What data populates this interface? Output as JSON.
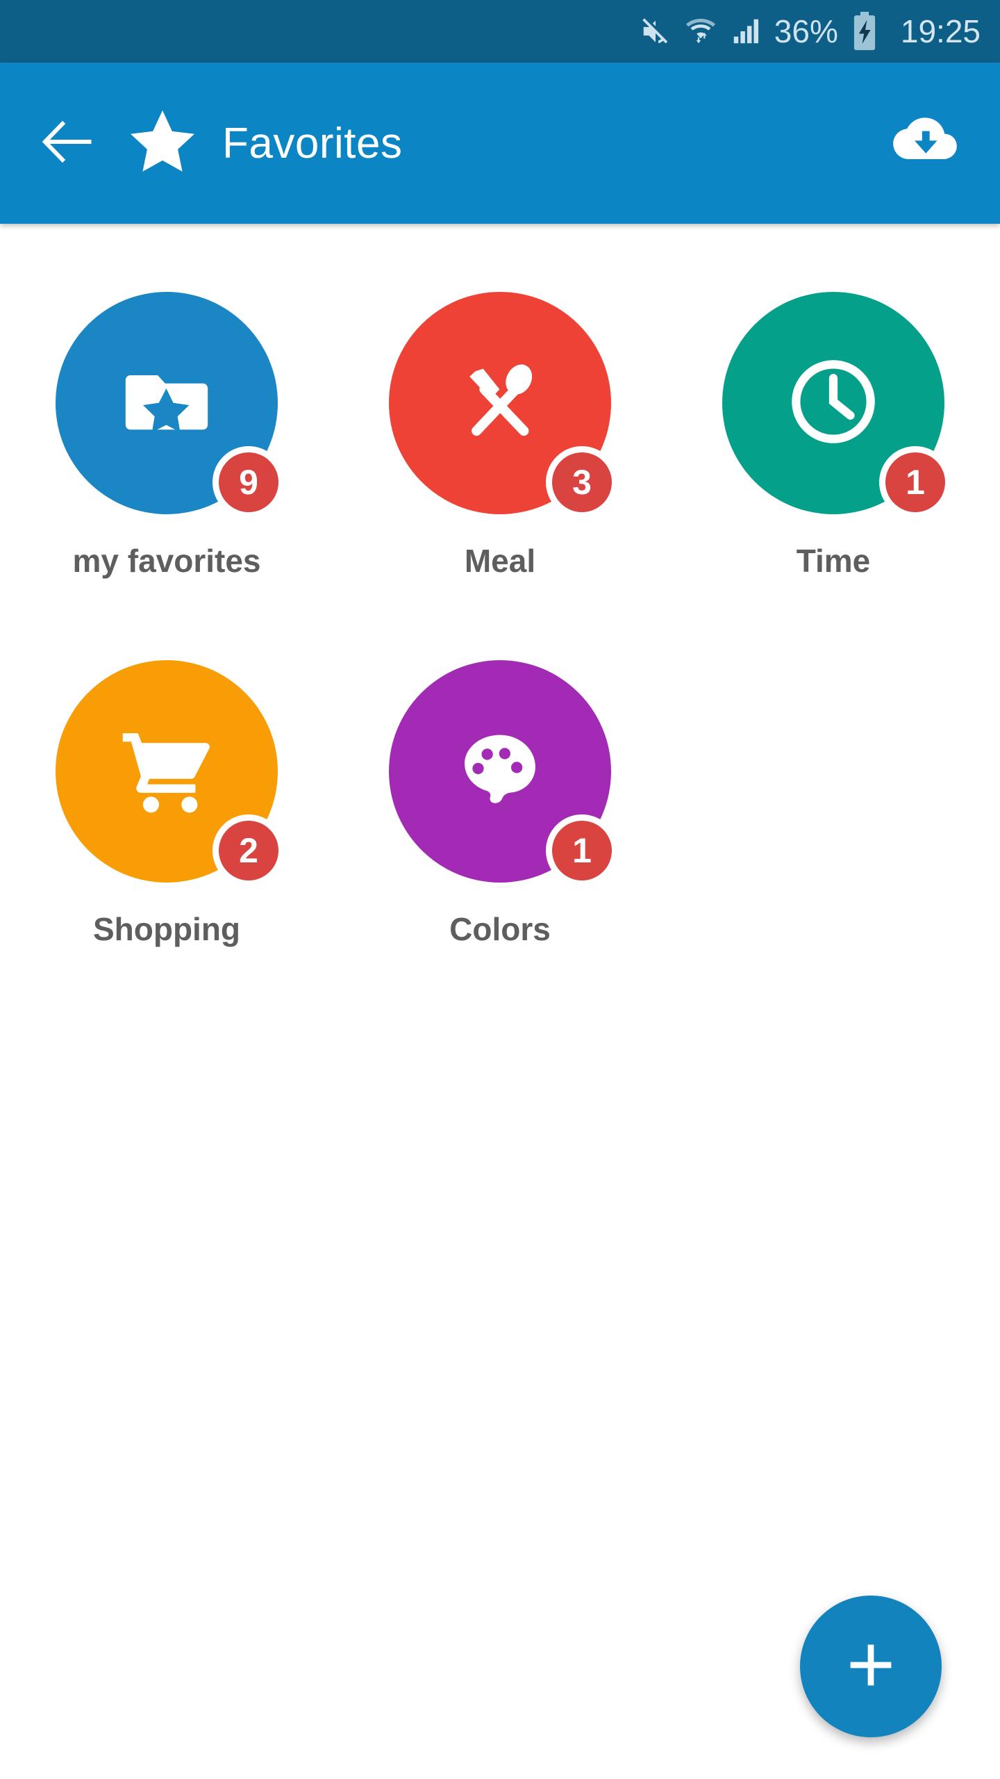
{
  "status_bar": {
    "battery_percent": "36%",
    "time": "19:25",
    "icons": [
      "mute-icon",
      "wifi-icon",
      "signal-icon",
      "battery-charging-icon"
    ],
    "background_color": "#0d5f87",
    "text_color": "#cfe3ee"
  },
  "app_bar": {
    "title": "Favorites",
    "back_icon": "back-arrow-icon",
    "brand_icon": "star-icon",
    "action_icon": "cloud-download-icon",
    "background_color": "#0c85c4",
    "title_color": "#ffffff"
  },
  "categories": [
    {
      "label": "my favorites",
      "badge": "9",
      "color": "#1a86c4",
      "icon": "folder-star-icon"
    },
    {
      "label": "Meal",
      "badge": "3",
      "color": "#ef4236",
      "icon": "cutlery-icon"
    },
    {
      "label": "Time",
      "badge": "1",
      "color": "#05a08a",
      "icon": "clock-icon"
    },
    {
      "label": "Shopping",
      "badge": "2",
      "color": "#f99d07",
      "icon": "shopping-cart-icon"
    },
    {
      "label": "Colors",
      "badge": "1",
      "color": "#a32ab4",
      "icon": "palette-icon"
    }
  ],
  "badge_color": "#d94440",
  "fab": {
    "icon": "plus-icon",
    "color": "#1283bd"
  }
}
